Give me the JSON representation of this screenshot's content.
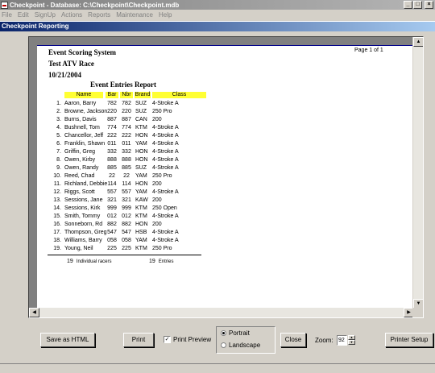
{
  "window": {
    "title": "Checkpoint - Database: C:\\Checkpoint\\Checkpoint.mdb"
  },
  "menu": [
    "File",
    "Edit",
    "SignUp",
    "Actions",
    "Reports",
    "Maintenance",
    "Help"
  ],
  "child_window": {
    "title": "Checkpoint Reporting"
  },
  "report": {
    "header1": "Event Scoring System",
    "header2": "Test ATV Race",
    "date": "10/21/2004",
    "page_label": "Page 1 of 1",
    "title": "Event Entries Report",
    "columns": {
      "name": "Name",
      "bar": "Bar",
      "nbr": "Nbr",
      "brand": "Brand",
      "class": "Class"
    },
    "highlight_color": "#ffff33",
    "rows": [
      {
        "num": "1.",
        "name": "Aaron, Barry",
        "bar": "782",
        "nbr": "782",
        "brand": "SUZ",
        "class": "4-Stroke A"
      },
      {
        "num": "2.",
        "name": "Browne, Jackson",
        "bar": "220",
        "nbr": "220",
        "brand": "SUZ",
        "class": "250 Pro"
      },
      {
        "num": "3.",
        "name": "Burns, Davis",
        "bar": "887",
        "nbr": "887",
        "brand": "CAN",
        "class": "200"
      },
      {
        "num": "4.",
        "name": "Bushnell, Tom",
        "bar": "774",
        "nbr": "774",
        "brand": "KTM",
        "class": "4-Stroke A"
      },
      {
        "num": "5.",
        "name": "Chancellor, Jeff",
        "bar": "222",
        "nbr": "222",
        "brand": "HON",
        "class": "4-Stroke A"
      },
      {
        "num": "6.",
        "name": "Franklin, Shawn",
        "bar": "011",
        "nbr": "011",
        "brand": "YAM",
        "class": "4-Stroke A"
      },
      {
        "num": "7.",
        "name": "Griffin, Greg",
        "bar": "332",
        "nbr": "332",
        "brand": "HON",
        "class": "4-Stroke A"
      },
      {
        "num": "8.",
        "name": "Owen, Kirby",
        "bar": "888",
        "nbr": "888",
        "brand": "HON",
        "class": "4-Stroke A"
      },
      {
        "num": "9.",
        "name": "Owen, Randy",
        "bar": "885",
        "nbr": "885",
        "brand": "SUZ",
        "class": "4-Stroke A"
      },
      {
        "num": "10.",
        "name": "Reed, Chad",
        "bar": "22",
        "nbr": "22",
        "brand": "YAM",
        "class": "250 Pro"
      },
      {
        "num": "11.",
        "name": "Richland, Debbie",
        "bar": "114",
        "nbr": "114",
        "brand": "HON",
        "class": "200"
      },
      {
        "num": "12.",
        "name": "Riggs, Scott",
        "bar": "557",
        "nbr": "557",
        "brand": "YAM",
        "class": "4-Stroke A"
      },
      {
        "num": "13.",
        "name": "Sessions, Jane",
        "bar": "321",
        "nbr": "321",
        "brand": "KAW",
        "class": "200"
      },
      {
        "num": "14.",
        "name": "Sessions, Kirk",
        "bar": "999",
        "nbr": "999",
        "brand": "KTM",
        "class": "250 Open"
      },
      {
        "num": "15.",
        "name": "Smith, Tommy",
        "bar": "012",
        "nbr": "012",
        "brand": "KTM",
        "class": "4-Stroke A"
      },
      {
        "num": "16.",
        "name": "Sonneborn, Rd",
        "bar": "882",
        "nbr": "882",
        "brand": "HON",
        "class": "200"
      },
      {
        "num": "17.",
        "name": "Thompson, Greg",
        "bar": "547",
        "nbr": "547",
        "brand": "HSB",
        "class": "4-Stroke A"
      },
      {
        "num": "18.",
        "name": "Williams, Barry",
        "bar": "058",
        "nbr": "058",
        "brand": "YAM",
        "class": "4-Stroke A"
      },
      {
        "num": "19.",
        "name": "Young, Neil",
        "bar": "225",
        "nbr": "225",
        "brand": "KTM",
        "class": "250 Pro"
      }
    ],
    "total_racers": "19",
    "total_racers_label": "Individual racers",
    "total_entries": "19",
    "total_entries_label": "Entries"
  },
  "controls": {
    "save_html": "Save as HTML",
    "print": "Print",
    "print_preview_label": "Print Preview",
    "print_preview_checked": true,
    "orientation_portrait": "Portrait",
    "orientation_landscape": "Landscape",
    "orientation_selected": "Portrait",
    "close": "Close",
    "zoom_label": "Zoom:",
    "zoom_value": "92",
    "printer_setup": "Printer Setup"
  }
}
